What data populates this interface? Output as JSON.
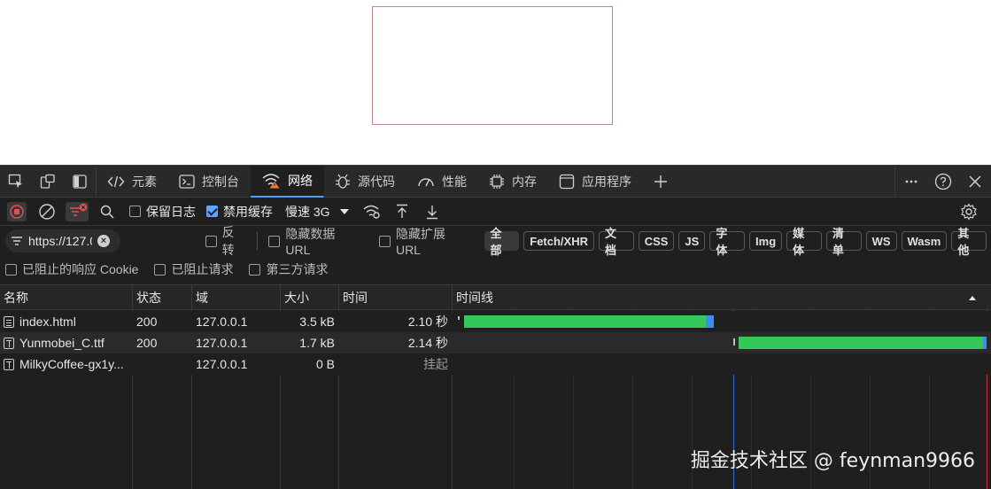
{
  "tabs": [
    {
      "label": "元素",
      "icon": "code-brackets-icon"
    },
    {
      "label": "控制台",
      "icon": "console-icon"
    },
    {
      "label": "网络",
      "icon": "wifi-warning-icon",
      "active": true
    },
    {
      "label": "源代码",
      "icon": "bug-icon"
    },
    {
      "label": "性能",
      "icon": "gauge-icon"
    },
    {
      "label": "内存",
      "icon": "chip-icon"
    },
    {
      "label": "应用程序",
      "icon": "app-window-icon"
    }
  ],
  "toolbar": {
    "preserve_log": "保留日志",
    "disable_cache": "禁用缓存",
    "throttle": "慢速 3G"
  },
  "filter": {
    "value": "https://127.0",
    "invert": "反转",
    "hide_data_url": "隐藏数据 URL",
    "hide_ext_url": "隐藏扩展 URL",
    "types": [
      "全部",
      "Fetch/XHR",
      "文档",
      "CSS",
      "JS",
      "字体",
      "Img",
      "媒体",
      "清单",
      "WS",
      "Wasm",
      "其他"
    ],
    "blocked_cookies": "已阻止的响应 Cookie",
    "blocked_requests": "已阻止请求",
    "third_party": "第三方请求"
  },
  "columns": {
    "name": "名称",
    "status": "状态",
    "domain": "域",
    "size": "大小",
    "time": "时间",
    "waterfall": "时间线"
  },
  "rows": [
    {
      "name": "index.html",
      "status": "200",
      "domain": "127.0.0.1",
      "size": "3.5 kB",
      "time": "2.10 秒",
      "icon": "document-icon"
    },
    {
      "name": "Yunmobei_C.ttf",
      "status": "200",
      "domain": "127.0.0.1",
      "size": "1.7 kB",
      "time": "2.14 秒",
      "icon": "font-icon"
    },
    {
      "name": "MilkyCoffee-gx1y...",
      "status": "",
      "domain": "127.0.0.1",
      "size": "0 B",
      "time": "挂起",
      "icon": "font-icon"
    }
  ],
  "colors": {
    "waiting": "#34c759",
    "download": "#3b8ff0",
    "accent": "#4aa3ff",
    "record": "#e05252"
  },
  "watermark": "掘金技术社区 @ feynman9966"
}
